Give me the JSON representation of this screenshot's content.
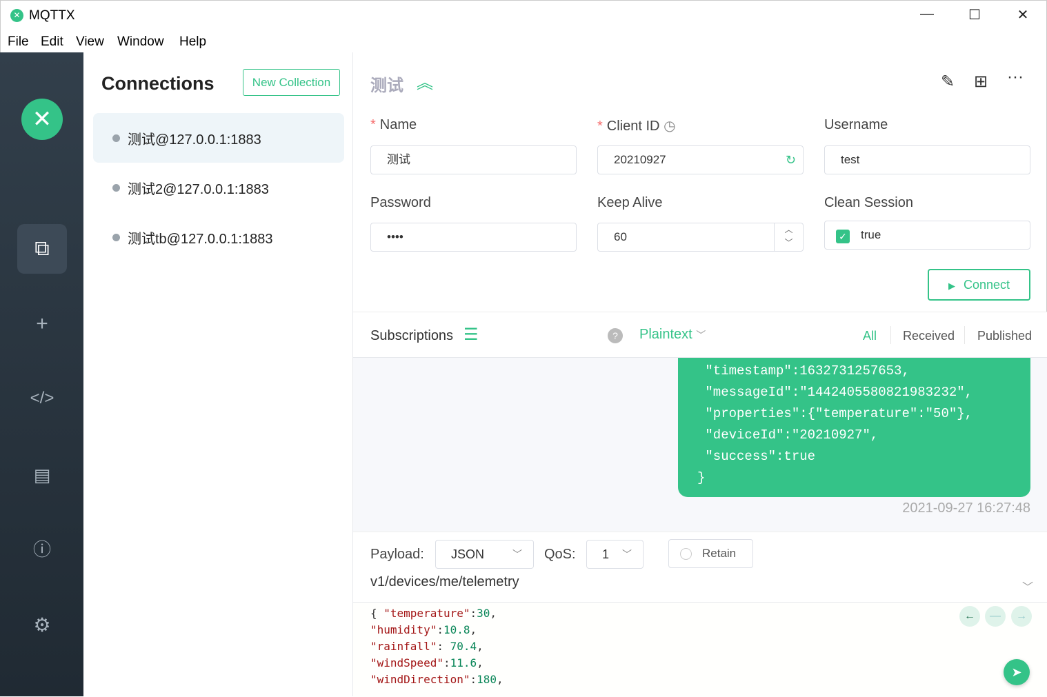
{
  "window": {
    "title": "MQTTX",
    "minimize": "—",
    "maximize": "☐",
    "close": "✕"
  },
  "menu": [
    "File",
    "Edit",
    "View",
    "Window",
    "Help"
  ],
  "colors": {
    "accent": "#34c388",
    "sidebar": "#2c3844"
  },
  "sidebar": {
    "items": [
      "connections-icon",
      "plus-icon",
      "code-icon",
      "log-icon",
      "info-icon",
      "gear-icon"
    ]
  },
  "connections": {
    "title": "Connections",
    "new_collection": "New Collection",
    "items": [
      {
        "label": "测试@127.0.0.1:1883"
      },
      {
        "label": "测试2@127.0.0.1:1883"
      },
      {
        "label": "测试tb@127.0.0.1:1883"
      }
    ]
  },
  "detail": {
    "name": "测试",
    "fields": {
      "name_label": "Name",
      "name_value": "测试",
      "client_id_label": "Client ID",
      "client_id_value": "20210927",
      "username_label": "Username",
      "username_value": "test",
      "password_label": "Password",
      "password_value": "••••",
      "keepalive_label": "Keep Alive",
      "keepalive_value": "60",
      "clean_label": "Clean Session",
      "clean_value": "true"
    },
    "connect": "Connect"
  },
  "subscriptions": {
    "label": "Subscriptions",
    "format": "Plaintext",
    "filters": [
      "All",
      "Received",
      "Published"
    ],
    "active_filter": "All"
  },
  "message": {
    "lines": [
      " \"timestamp\":1632731257653,",
      " \"messageId\":\"1442405580821983232\",",
      " \"properties\":{\"temperature\":\"50\"},",
      " \"deviceId\":\"20210927\",",
      " \"success\":true",
      "}"
    ],
    "time": "2021-09-27 16:27:48"
  },
  "publish": {
    "payload_label": "Payload:",
    "payload_format": "JSON",
    "qos_label": "QoS:",
    "qos": "1",
    "retain": "Retain",
    "topic": "v1/devices/me/telemetry",
    "payload_lines": [
      [
        "{ ",
        "\"temperature\"",
        ":",
        "30",
        ","
      ],
      [
        "",
        "\"humidity\"",
        ":",
        "10.8",
        ","
      ],
      [
        "",
        "\"rainfall\"",
        ": ",
        "70.4",
        ","
      ],
      [
        "",
        "\"windSpeed\"",
        ":",
        "11.6",
        ","
      ],
      [
        "",
        "\"windDirection\"",
        ":",
        "180",
        ","
      ]
    ]
  }
}
